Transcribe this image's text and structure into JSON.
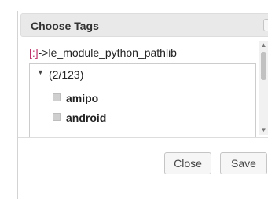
{
  "dialog": {
    "title": "Choose Tags"
  },
  "path": {
    "prefix": "[:]",
    "text": "->le_module_python_pathlib"
  },
  "tree": {
    "toggle_glyph": "▼",
    "count": "(2/123)"
  },
  "tags": [
    {
      "label": "amipo",
      "checked": false
    },
    {
      "label": "android",
      "checked": false
    }
  ],
  "scrollbar": {
    "up_glyph": "▲",
    "down_glyph": "▼"
  },
  "buttons": {
    "close_label": "Close",
    "save_label": "Save"
  }
}
